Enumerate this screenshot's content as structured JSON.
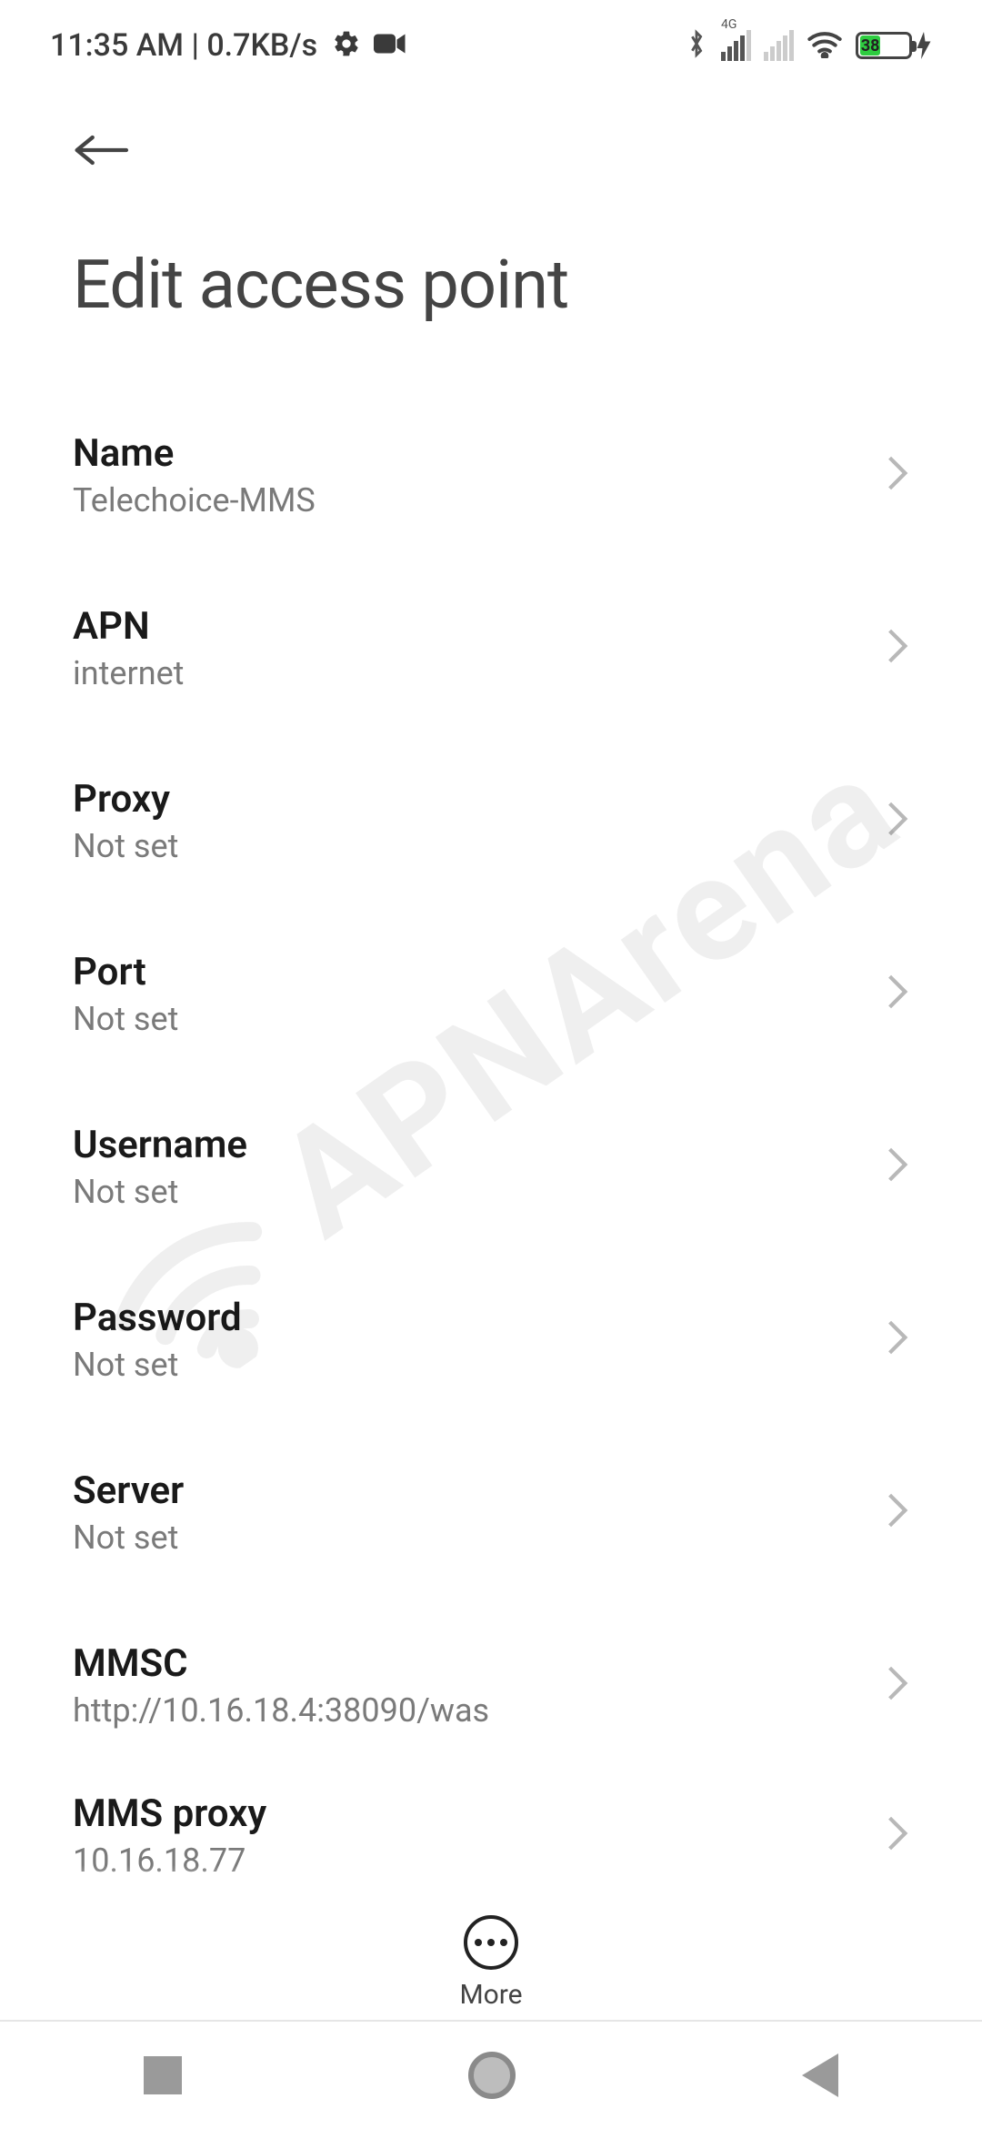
{
  "status_bar": {
    "time": "11:35 AM",
    "data_rate": "0.7KB/s",
    "battery_pct": "38",
    "network_label": "4G"
  },
  "header": {
    "title": "Edit access point"
  },
  "rows": {
    "name": {
      "label": "Name",
      "value": "Telechoice-MMS"
    },
    "apn": {
      "label": "APN",
      "value": "internet"
    },
    "proxy": {
      "label": "Proxy",
      "value": "Not set"
    },
    "port": {
      "label": "Port",
      "value": "Not set"
    },
    "username": {
      "label": "Username",
      "value": "Not set"
    },
    "password": {
      "label": "Password",
      "value": "Not set"
    },
    "server": {
      "label": "Server",
      "value": "Not set"
    },
    "mmsc": {
      "label": "MMSC",
      "value": "http://10.16.18.4:38090/was"
    },
    "mmsproxy": {
      "label": "MMS proxy",
      "value": "10.16.18.77"
    }
  },
  "bottom": {
    "more_label": "More"
  },
  "watermark": "APNArena"
}
